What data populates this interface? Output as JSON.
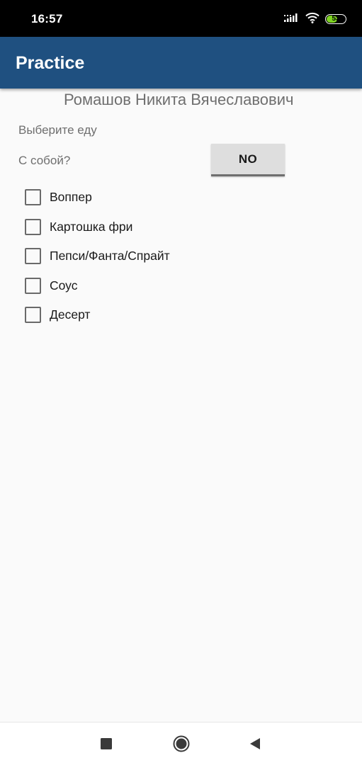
{
  "status_bar": {
    "time": "16:57",
    "battery_level": "53",
    "icons": [
      "signal-icon",
      "wifi-icon",
      "battery-icon"
    ]
  },
  "app_bar": {
    "title": "Practice"
  },
  "main": {
    "full_name": "Ромашов Никита Вячеславович",
    "choose_food_label": "Выберите еду",
    "takeaway_label": "С собой?",
    "takeaway_toggle_value": "NO",
    "options": [
      {
        "label": "Воппер",
        "checked": false
      },
      {
        "label": "Картошка фри",
        "checked": false
      },
      {
        "label": "Пепси/Фанта/Спрайт",
        "checked": false
      },
      {
        "label": "Соус",
        "checked": false
      },
      {
        "label": "Десерт",
        "checked": false
      }
    ]
  },
  "nav_bar": {
    "icons": [
      "recents-square-icon",
      "home-circle-icon",
      "back-triangle-icon"
    ]
  },
  "colors": {
    "app_bar": "#1f5080",
    "background": "#fafafa",
    "button": "#dedede",
    "battery": "#7ed321"
  }
}
